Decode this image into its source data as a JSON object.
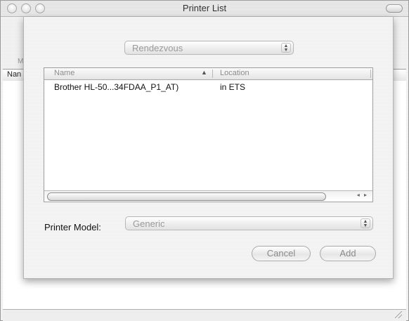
{
  "window": {
    "title": "Printer List"
  },
  "background": {
    "tab_label_partial": "M",
    "column_name_partial": "Nan"
  },
  "sheet": {
    "connection_popup": {
      "value": "Rendezvous",
      "stepper_glyph": "▲▼"
    },
    "table": {
      "columns": [
        {
          "label": "Name",
          "sort_indicator": "▲"
        },
        {
          "label": "Location"
        }
      ],
      "rows": [
        {
          "name": "Brother HL-50...34FDAA_P1_AT)",
          "location": "in ETS"
        }
      ],
      "scroll_arrows": "◂ ▸"
    },
    "printer_model": {
      "label": "Printer Model:",
      "value": "Generic",
      "stepper_glyph": "▲▼"
    },
    "buttons": {
      "cancel": "Cancel",
      "add": "Add"
    }
  },
  "colors": {
    "disabled_text": "#9a9a9a",
    "window_border": "#9a9a9a"
  }
}
